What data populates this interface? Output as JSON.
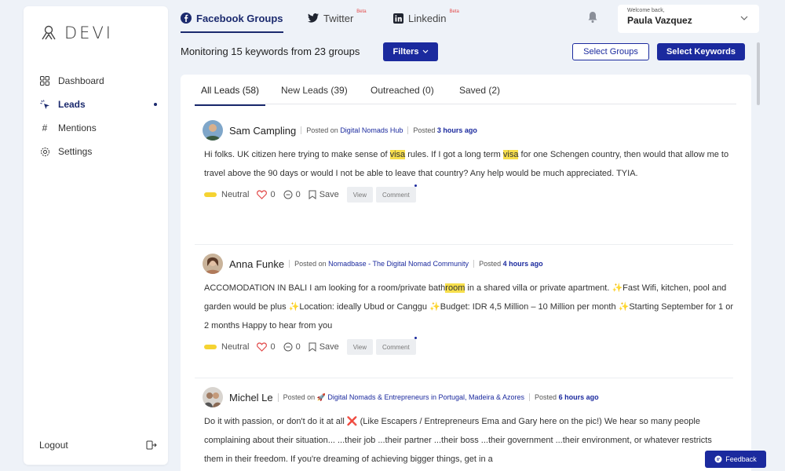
{
  "app": {
    "logo_text": "DEVI"
  },
  "sidebar": {
    "items": [
      {
        "label": "Dashboard",
        "icon": "grid-icon"
      },
      {
        "label": "Leads",
        "icon": "cursor-click-icon"
      },
      {
        "label": "Mentions",
        "icon": "hash-icon"
      },
      {
        "label": "Settings",
        "icon": "gear-icon"
      }
    ],
    "logout_label": "Logout"
  },
  "top_tabs": [
    {
      "label": "Facebook Groups",
      "icon": "facebook-icon"
    },
    {
      "label": "Twitter",
      "icon": "twitter-icon",
      "badge": "Beta"
    },
    {
      "label": "Linkedin",
      "icon": "linkedin-icon",
      "badge": "Beta"
    }
  ],
  "user": {
    "welcome": "Welcome back,",
    "name": "Paula Vazquez"
  },
  "controls": {
    "monitoring_text": "Monitoring 15 keywords from 23 groups",
    "filters_label": "Filters",
    "select_groups_label": "Select Groups",
    "select_keywords_label": "Select Keywords"
  },
  "lead_tabs": [
    {
      "label": "All Leads (58)"
    },
    {
      "label": "New Leads (39)"
    },
    {
      "label": "Outreached (0)"
    },
    {
      "label": "Saved (2)"
    }
  ],
  "posts": [
    {
      "author": "Sam Campling",
      "posted_on_label": "Posted on",
      "group": "Digital Nomads Hub",
      "posted_label": "Posted",
      "time": "3 hours ago",
      "body": {
        "t1": "Hi folks. UK citizen here trying to make sense of ",
        "h1": "visa",
        "t2": " rules. If I got a long term ",
        "h2": "visa",
        "t3": " for one Schengen country, then would that allow me to travel above the 90 days or would I not be able to leave that country? Any help would be much appreciated. TYIA."
      },
      "sentiment": "Neutral",
      "likes": "0",
      "comments": "0",
      "save_label": "Save",
      "view_label": "View",
      "comment_label": "Comment"
    },
    {
      "author": "Anna Funke",
      "posted_on_label": "Posted on",
      "group": "Nomadbase - The Digital Nomad Community",
      "posted_label": "Posted",
      "time": "4 hours ago",
      "body": {
        "t1": "ACCOMODATION IN BALI I am looking for a room/private bath",
        "h1": "room",
        "t2": " in a shared villa or private apartment. ",
        "s1": "✨",
        "t3": "Fast Wifi, kitchen, pool and garden would be plus ",
        "s2": "✨",
        "t4": "Location: ideally Ubud or Canggu ",
        "s3": "✨",
        "t5": "Budget: IDR 4,5 Million – 10 Million per month ",
        "s4": "✨",
        "t6": "Starting September for 1 or 2 months Happy to hear from you"
      },
      "sentiment": "Neutral",
      "likes": "0",
      "comments": "0",
      "save_label": "Save",
      "view_label": "View",
      "comment_label": "Comment"
    },
    {
      "author": "Michel Le",
      "posted_on_label": "Posted on",
      "group_icon": "🚀",
      "group": "Digital Nomads & Entrepreneurs in Portugal, Madeira & Azores",
      "posted_label": "Posted",
      "time": "6 hours ago",
      "body": {
        "t1": "Do it with passion, or don't do it at all ",
        "x": "❌",
        "t2": " (Like Escapers / Entrepreneurs Ema and Gary here on the pic!) We hear so many people complaining about their situation... ...their job ...their partner ...their boss ...their government ...their environment, or whatever restricts them in their freedom. If you're dreaming of achieving bigger things, get in a"
      }
    }
  ],
  "feedback_label": "Feedback",
  "colors": {
    "primary": "#1b2a9e",
    "highlight": "#f7df4c",
    "neutral_pill": "#f5d332",
    "like": "#e24b4b"
  }
}
